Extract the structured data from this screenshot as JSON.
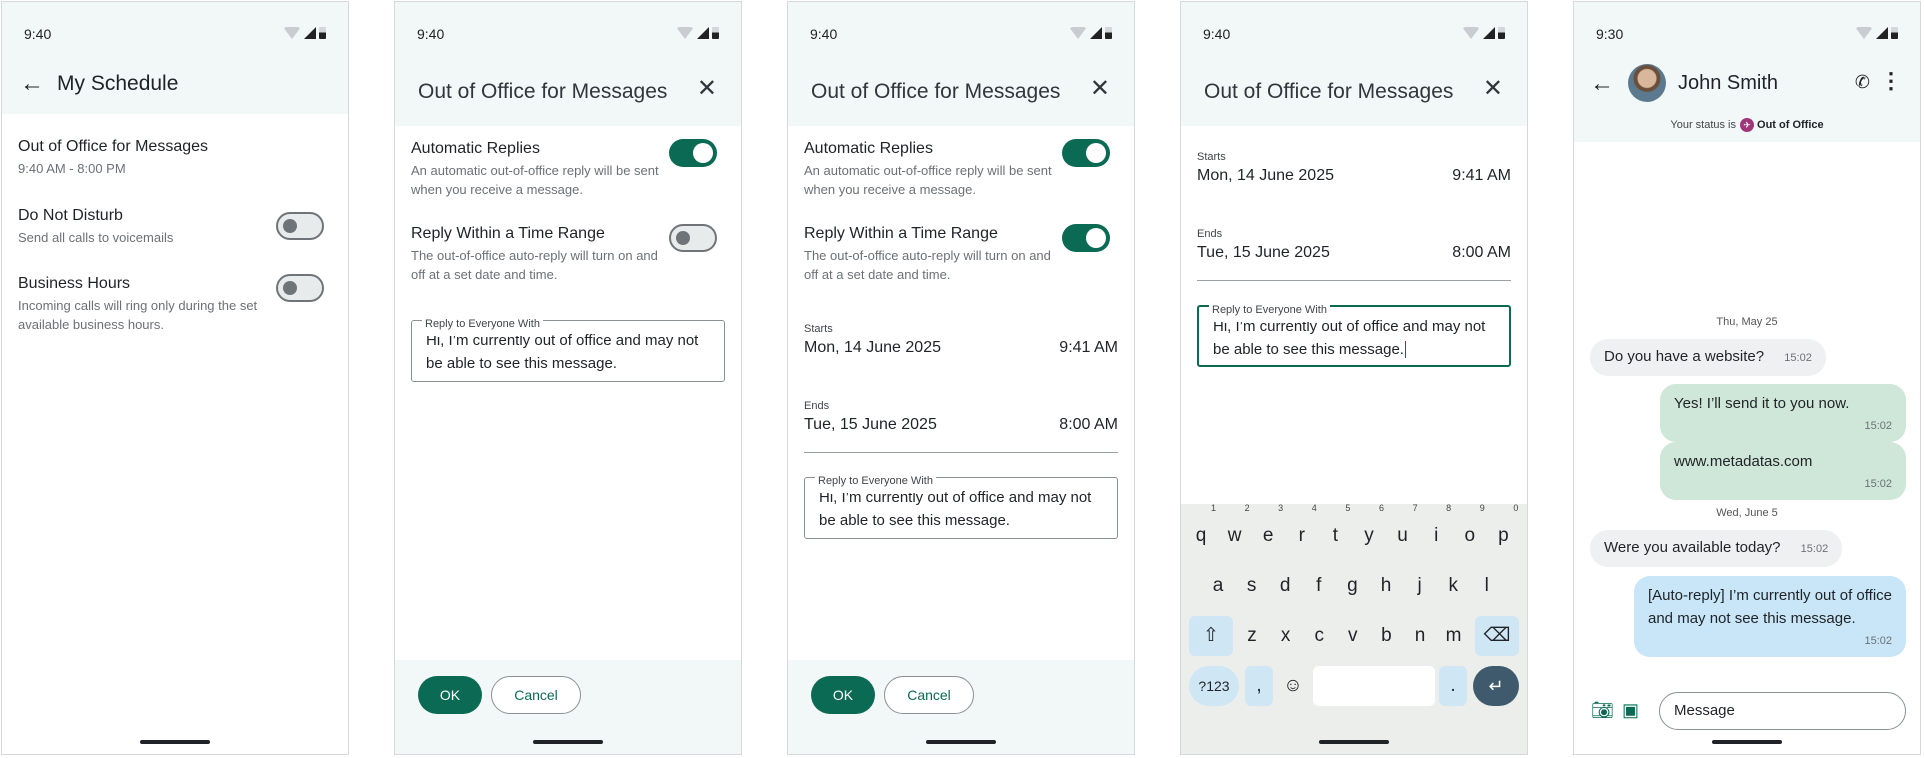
{
  "status": {
    "time_a": "9:40",
    "time_b": "9:30"
  },
  "screen1": {
    "title": "My Schedule",
    "items": [
      {
        "title": "Out of Office for Messages",
        "subtitle": "9:40 AM - 8:00 PM"
      },
      {
        "title": "Do Not Disturb",
        "subtitle": "Send all calls to voicemails"
      },
      {
        "title": "Business Hours",
        "subtitle": "Incoming calls will ring only during the set available business hours."
      }
    ]
  },
  "dialog": {
    "title": "Out of Office for Messages",
    "auto_title": "Automatic Replies",
    "auto_sub": "An automatic out-of-office reply will be sent when you receive a message.",
    "range_title": "Reply Within a Time Range",
    "range_sub": "The out-of-office auto-reply will turn on and off at a set date and time.",
    "field_label": "Reply to Everyone With",
    "field_value": "Hi, I’m currently out of office and may not be able to see this message.",
    "starts_label": "Starts",
    "starts_date": "Mon, 14 June 2025",
    "starts_time": "9:41 AM",
    "ends_label": "Ends",
    "ends_date": "Tue, 15 June 2025",
    "ends_time": "8:00 AM",
    "ok": "OK",
    "cancel": "Cancel"
  },
  "keyboard": {
    "row1": [
      "q",
      "w",
      "e",
      "r",
      "t",
      "y",
      "u",
      "i",
      "o",
      "p"
    ],
    "row1_hints": [
      "1",
      "2",
      "3",
      "4",
      "5",
      "6",
      "7",
      "8",
      "9",
      "0"
    ],
    "row2": [
      "a",
      "s",
      "d",
      "f",
      "g",
      "h",
      "j",
      "k",
      "l"
    ],
    "row3": [
      "z",
      "x",
      "c",
      "v",
      "b",
      "n",
      "m"
    ],
    "sym": "?123",
    "comma": ",",
    "period": "."
  },
  "chat": {
    "contact": "John Smith",
    "status_prefix": "Your status is",
    "status_value": "Out of Office",
    "date1": "Thu, May 25",
    "date2": "Wed, June 5",
    "messages": [
      {
        "text": "Do you have a website?",
        "time": "15:02"
      },
      {
        "text": "Yes! I’ll send it to you now.",
        "time": "15:02"
      },
      {
        "text": "www.metadatas.com",
        "time": "15:02"
      },
      {
        "text": "Were you available today?",
        "time": "15:02"
      },
      {
        "text": "[Auto-reply] I’m currently out of office and may not see this message.",
        "time": "15:02"
      }
    ],
    "composer_placeholder": "Message"
  }
}
